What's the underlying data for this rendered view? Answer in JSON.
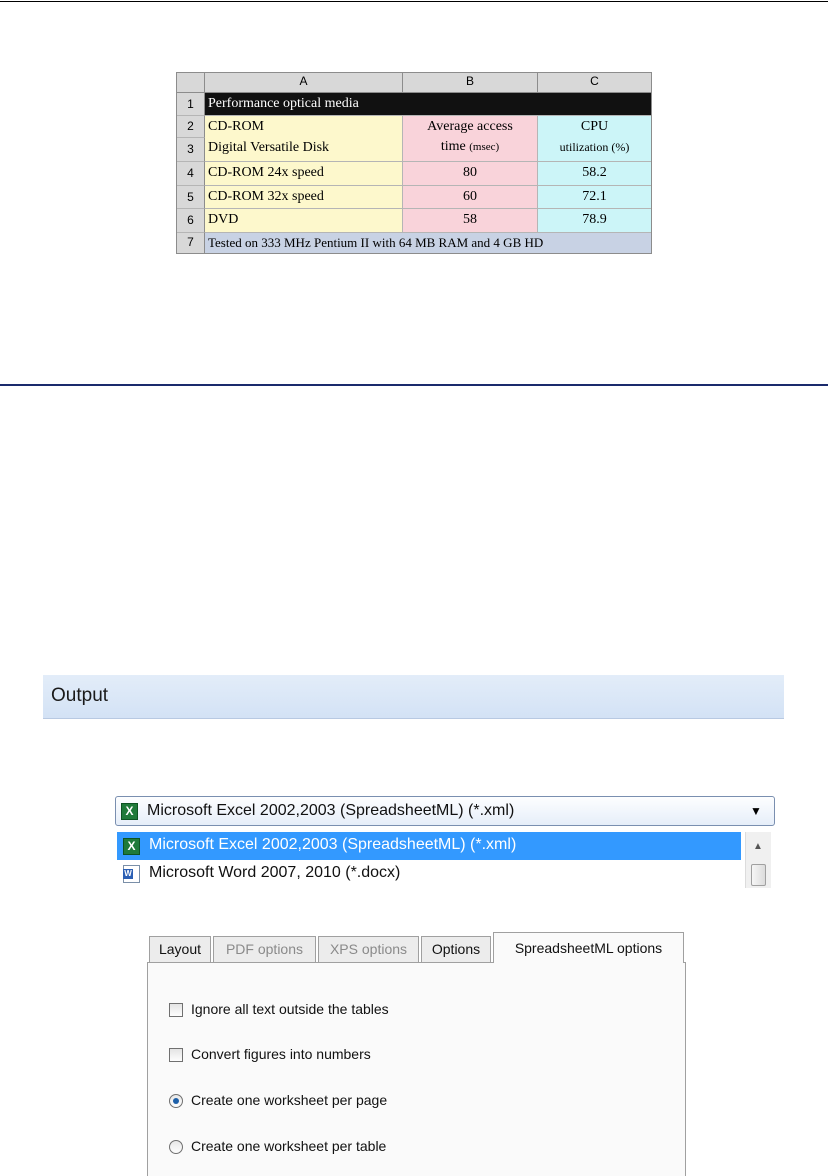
{
  "spreadsheet": {
    "columns": [
      "A",
      "B",
      "C"
    ],
    "rows": [
      "1",
      "2",
      "3",
      "4",
      "5",
      "6",
      "7"
    ],
    "title": "Performance optical media",
    "row2_a": "CD-ROM",
    "row3_a": "Digital Versatile Disk",
    "b_header_1": "Average access",
    "b_header_2a": "time ",
    "b_header_2b": "(msec)",
    "c_header_1": "CPU",
    "c_header_2": "utilization (%)",
    "data": [
      {
        "name": "CD-ROM 24x speed",
        "access": "80",
        "cpu": "58.2"
      },
      {
        "name": "CD-ROM 32x speed",
        "access": "60",
        "cpu": "72.1"
      },
      {
        "name": "DVD",
        "access": "58",
        "cpu": "78.9"
      }
    ],
    "footer": "Tested on 333 MHz Pentium II with 64 MB RAM and 4 GB HD"
  },
  "output": {
    "title": "Output",
    "selected": "Microsoft Excel 2002,2003 (SpreadsheetML) (*.xml)",
    "options": [
      {
        "label": "Microsoft Excel 2002,2003 (SpreadsheetML) (*.xml)",
        "icon": "excel-icon"
      },
      {
        "label": "Microsoft Word 2007, 2010 (*.docx)",
        "icon": "word-icon"
      }
    ]
  },
  "options_dialog": {
    "tabs": [
      "Layout",
      "PDF options",
      "XPS options",
      "Options",
      "SpreadsheetML options"
    ],
    "active_tab": "SpreadsheetML options",
    "checkboxes": [
      {
        "label": "Ignore all text outside the tables",
        "checked": false
      },
      {
        "label": "Convert figures into numbers",
        "checked": false
      }
    ],
    "radios": [
      {
        "label": "Create one worksheet per page",
        "selected": true
      },
      {
        "label": "Create one worksheet per table",
        "selected": false
      }
    ]
  },
  "colors": {
    "accent_blue": "#3399ff",
    "divider": "#1a2a6c"
  }
}
